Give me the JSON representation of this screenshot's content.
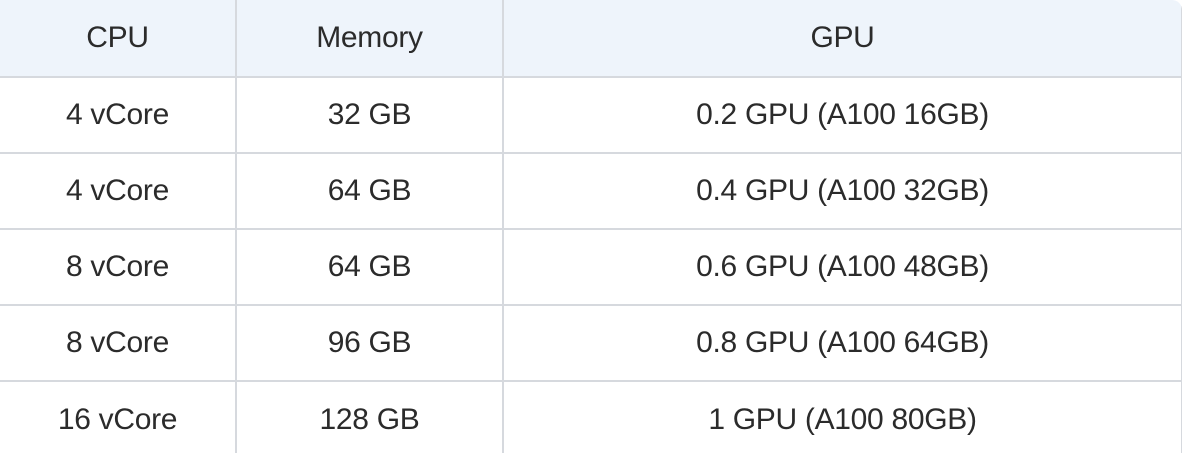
{
  "table": {
    "headers": [
      "CPU",
      "Memory",
      "GPU"
    ],
    "rows": [
      [
        "4 vCore",
        "32 GB",
        "0.2 GPU (A100 16GB)"
      ],
      [
        "4 vCore",
        "64 GB",
        "0.4 GPU (A100 32GB)"
      ],
      [
        "8 vCore",
        "64 GB",
        "0.6 GPU (A100 48GB)"
      ],
      [
        "8 vCore",
        "96 GB",
        "0.8 GPU (A100 64GB)"
      ],
      [
        "16 vCore",
        "128 GB",
        "1 GPU (A100 80GB)"
      ]
    ]
  }
}
